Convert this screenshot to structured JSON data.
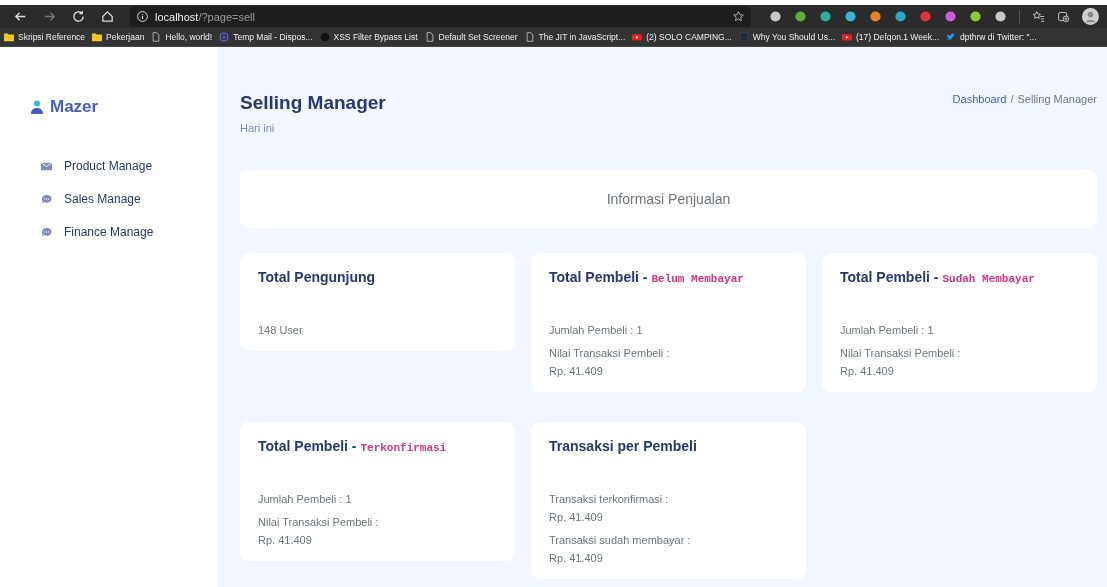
{
  "browser": {
    "address_host": "localhost",
    "address_path": "/?page=sell",
    "extensions": [
      {
        "color": "#c8c8c8"
      },
      {
        "color": "#5fae3a"
      },
      {
        "color": "#2bb0a0"
      },
      {
        "color": "#36b6d6"
      },
      {
        "color": "#e8822a"
      },
      {
        "color": "#2aa8c8"
      },
      {
        "color": "#e0343a"
      },
      {
        "color": "#c860e0"
      },
      {
        "color": "#8ec83a"
      },
      {
        "color": "#c8c8c8"
      }
    ],
    "bookmarks": [
      {
        "kind": "folder",
        "label": "Skripsi Reference"
      },
      {
        "kind": "folder",
        "label": "Pekerjaan"
      },
      {
        "kind": "page",
        "label": "Hello, world!"
      },
      {
        "kind": "mail",
        "label": "Temp Mail - Dispos..."
      },
      {
        "kind": "github",
        "label": "XSS Filter Bypass List"
      },
      {
        "kind": "page",
        "label": "Default Set Screener"
      },
      {
        "kind": "page",
        "label": "The JIT in JavaScript..."
      },
      {
        "kind": "video",
        "label": "(2) SOLO CAMPING..."
      },
      {
        "kind": "book",
        "label": "Why You Should Us..."
      },
      {
        "kind": "video",
        "label": "(17) Defqon.1 Week..."
      },
      {
        "kind": "bird",
        "label": "dpthrw di Twitter: \"..."
      }
    ]
  },
  "sidebar": {
    "brand": "Mazer",
    "items": [
      {
        "label": "Product Manage",
        "kind": "mail"
      },
      {
        "label": "Sales Manage",
        "kind": "chat"
      },
      {
        "label": "Finance Manage",
        "kind": "chat"
      }
    ]
  },
  "header": {
    "title": "Selling Manager",
    "subtitle": "Hari ini",
    "separator": "/",
    "breadcrumb": [
      {
        "label": "Dashboard",
        "link": true
      },
      {
        "label": "Selling Manager",
        "link": false
      }
    ]
  },
  "info_banner": "Informasi Penjualan",
  "cards": [
    {
      "title": "Total Pengunjung",
      "items": [
        {
          "label": "148 User"
        }
      ]
    },
    {
      "title": "Total Pembeli - ",
      "tag": "Belum Membayar",
      "items": [
        {
          "label": "Jumlah Pembeli : 1"
        },
        {
          "label": "Nilai Transaksi Pembeli :",
          "value": "Rp. 41.409"
        }
      ]
    },
    {
      "title": "Total Pembeli - ",
      "tag": "Sudah Membayar",
      "items": [
        {
          "label": "Jumlah Pembeli : 1"
        },
        {
          "label": "Nilai Transaksi Pembeli :",
          "value": "Rp. 41.409"
        }
      ]
    },
    {
      "title": "Total Pembeli - ",
      "tag": "Terkonfirmasi",
      "items": [
        {
          "label": "Jumlah Pembeli : 1"
        },
        {
          "label": "Nilai Transaksi Pembeli :",
          "value": "Rp. 41.409"
        }
      ]
    },
    {
      "title": "Transaksi per Pembeli",
      "items": [
        {
          "label": "Transaksi terkonfirmasi :",
          "value": "Rp. 41.409"
        },
        {
          "label": "Transaksi sudah membayar :",
          "value": "Rp. 41.409"
        }
      ]
    }
  ]
}
